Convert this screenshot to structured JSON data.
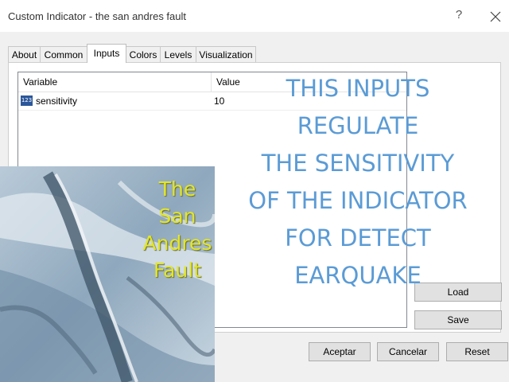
{
  "window": {
    "title": "Custom Indicator - the san andres fault",
    "help_glyph": "?"
  },
  "tabs": [
    {
      "label": "About"
    },
    {
      "label": "Common"
    },
    {
      "label": "Inputs"
    },
    {
      "label": "Colors"
    },
    {
      "label": "Levels"
    },
    {
      "label": "Visualization"
    }
  ],
  "active_tab": "Inputs",
  "inputs_table": {
    "headers": {
      "variable": "Variable",
      "value": "Value"
    },
    "rows": [
      {
        "icon": "numeric-type-icon",
        "icon_text": "123",
        "variable": "sensitivity",
        "value": "10"
      }
    ]
  },
  "side_buttons": {
    "load": "Load",
    "save": "Save"
  },
  "footer_buttons": {
    "accept": "Aceptar",
    "cancel": "Cancelar",
    "reset": "Reset"
  },
  "image_overlay": {
    "label_lines": [
      "The San",
      "Andres",
      "Fault"
    ]
  },
  "annotation": {
    "lines": [
      "THIS INPUTS",
      "REGULATE",
      "THE SENSITIVITY",
      "OF THE INDICATOR",
      "FOR DETECT",
      "EARQUAKE"
    ],
    "color": "#5b9bd5"
  },
  "colors": {
    "overlay_text": "#5b9bd5",
    "photo_label": "#e2e62a",
    "dialog_bg": "#f0f0f0"
  }
}
